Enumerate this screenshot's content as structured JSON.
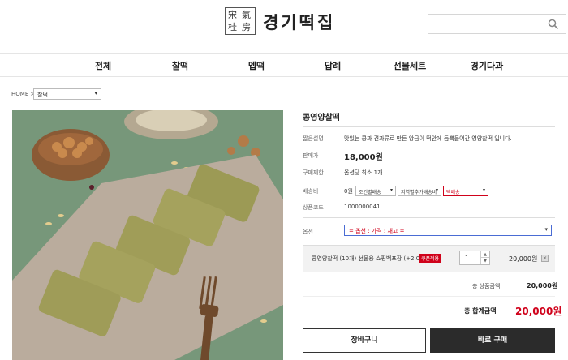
{
  "brand": {
    "logo_chars": [
      "宋",
      "氣",
      "桂",
      "房"
    ],
    "name": "경기떡집"
  },
  "nav": [
    {
      "label": "전체"
    },
    {
      "label": "찰떡"
    },
    {
      "label": "멥떡"
    },
    {
      "label": "답례"
    },
    {
      "label": "선물세트"
    },
    {
      "label": "경기다과"
    }
  ],
  "breadcrumb": {
    "home": "HOME >",
    "category": "찰떡"
  },
  "product": {
    "title": "콩영양찰떡",
    "rows": [
      {
        "label": "짧은설명",
        "value": "맛있는 콩과 견과류로 만든 앙금이 떡안에 듬뿍들어간 영양찰떡 입니다."
      },
      {
        "label": "판매가",
        "value": "18,000원"
      },
      {
        "label": "구매제한",
        "value": "옵션당 최소 1개"
      },
      {
        "label": "배송비",
        "value": "0원"
      },
      {
        "label": "상품코드",
        "value": "1000000041"
      },
      {
        "label": "옵션",
        "value": ""
      }
    ],
    "shipping_selects": [
      "조건별배송",
      "지역별추가배송비",
      "택배송"
    ],
    "option_placeholder": "= 옵션 : 가격 : 재고 ="
  },
  "selected_item": {
    "name": "콩영양찰떡 (10개) 선물용 쇼핑백포장 (+2,000원)",
    "coupon": "쿠폰적용",
    "quantity": "1",
    "price": "20,000원",
    "delete": "×"
  },
  "summary": {
    "subtotal_label": "총 상품금액",
    "subtotal_value": "20,000원",
    "total_label": "총 합계금액",
    "total_value": "20,000원"
  },
  "buttons": {
    "cart": "장바구니",
    "buy": "바로 구매"
  },
  "colors": {
    "accent_red": "#d0021b",
    "buy_button": "#2b2b2b",
    "photo_background": "#7a9a7c"
  }
}
